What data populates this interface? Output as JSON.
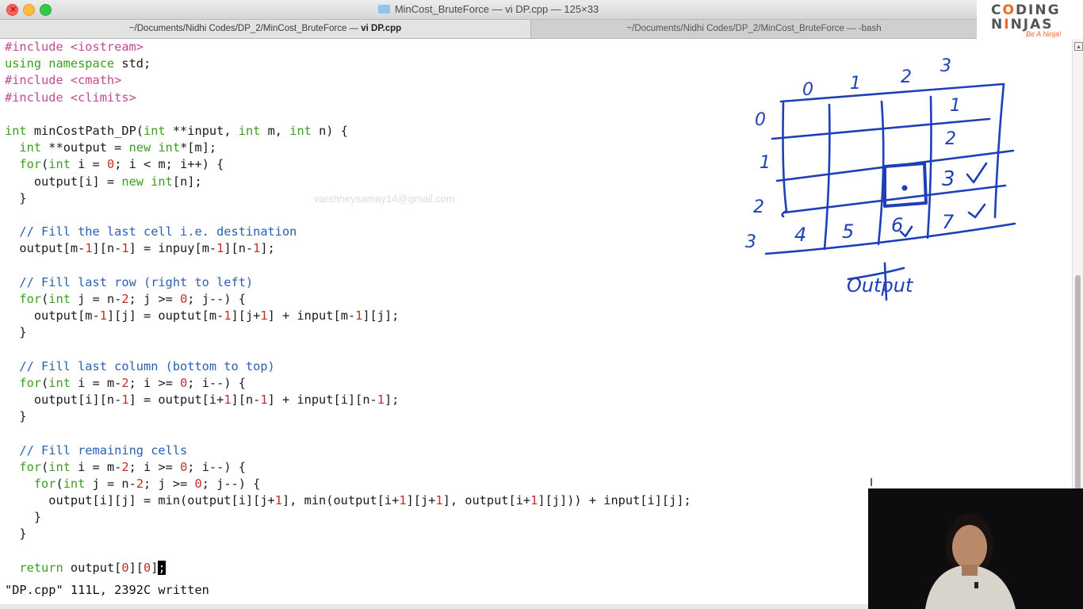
{
  "window": {
    "title": "MinCost_BruteForce — vi DP.cpp — 125×33",
    "close_glyph": "×"
  },
  "tabs": [
    {
      "path": "~/Documents/Nidhi Codes/DP_2/MinCost_BruteForce — ",
      "name": "vi DP.cpp",
      "active": true
    },
    {
      "path": "~/Documents/Nidhi Codes/DP_2/MinCost_BruteForce — -bash",
      "active": false
    }
  ],
  "logo": {
    "line1_a": "C",
    "line1_o": "O",
    "line1_b": "DING",
    "line2_a": "N",
    "line2_o": "I",
    "line2_b": "NJAS",
    "tagline": "Be A Ninja!"
  },
  "editor": {
    "watermark": "varshneysamay14@gmail.com",
    "status": "\"DP.cpp\" 111L, 2392C written",
    "code_lines": [
      [
        {
          "t": "#include <iostream>",
          "c": "pp"
        }
      ],
      [
        {
          "t": "using namespace",
          "c": "kw"
        },
        {
          "t": " std;"
        }
      ],
      [
        {
          "t": "#include <cmath>",
          "c": "pp"
        }
      ],
      [
        {
          "t": "#include <climits>",
          "c": "pp"
        }
      ],
      [],
      [
        {
          "t": "int",
          "c": "kw"
        },
        {
          "t": " minCostPath_DP("
        },
        {
          "t": "int",
          "c": "kw"
        },
        {
          "t": " **input, "
        },
        {
          "t": "int",
          "c": "kw"
        },
        {
          "t": " m, "
        },
        {
          "t": "int",
          "c": "kw"
        },
        {
          "t": " n) {"
        }
      ],
      [
        {
          "t": "  "
        },
        {
          "t": "int",
          "c": "kw"
        },
        {
          "t": " **output = "
        },
        {
          "t": "new",
          "c": "kw"
        },
        {
          "t": " "
        },
        {
          "t": "int",
          "c": "kw"
        },
        {
          "t": "*[m];"
        }
      ],
      [
        {
          "t": "  "
        },
        {
          "t": "for",
          "c": "kw"
        },
        {
          "t": "("
        },
        {
          "t": "int",
          "c": "kw"
        },
        {
          "t": " i = "
        },
        {
          "t": "0",
          "c": "num"
        },
        {
          "t": "; i < m; i++) {"
        }
      ],
      [
        {
          "t": "    output[i] = "
        },
        {
          "t": "new",
          "c": "kw"
        },
        {
          "t": " "
        },
        {
          "t": "int",
          "c": "kw"
        },
        {
          "t": "[n];"
        }
      ],
      [
        {
          "t": "  }"
        }
      ],
      [],
      [
        {
          "t": "  "
        },
        {
          "t": "// Fill the last cell i.e. destination",
          "c": "cm"
        }
      ],
      [
        {
          "t": "  output[m-"
        },
        {
          "t": "1",
          "c": "num"
        },
        {
          "t": "][n-"
        },
        {
          "t": "1",
          "c": "num"
        },
        {
          "t": "] = inpuy[m-"
        },
        {
          "t": "1",
          "c": "num"
        },
        {
          "t": "][n-"
        },
        {
          "t": "1",
          "c": "num"
        },
        {
          "t": "];"
        }
      ],
      [],
      [
        {
          "t": "  "
        },
        {
          "t": "// Fill last row (right to left)",
          "c": "cm"
        }
      ],
      [
        {
          "t": "  "
        },
        {
          "t": "for",
          "c": "kw"
        },
        {
          "t": "("
        },
        {
          "t": "int",
          "c": "kw"
        },
        {
          "t": " j = n-"
        },
        {
          "t": "2",
          "c": "num"
        },
        {
          "t": "; j >= "
        },
        {
          "t": "0",
          "c": "num"
        },
        {
          "t": "; j--) {"
        }
      ],
      [
        {
          "t": "    output[m-"
        },
        {
          "t": "1",
          "c": "num"
        },
        {
          "t": "][j] = ouptut[m-"
        },
        {
          "t": "1",
          "c": "num"
        },
        {
          "t": "][j+"
        },
        {
          "t": "1",
          "c": "num"
        },
        {
          "t": "] + input[m-"
        },
        {
          "t": "1",
          "c": "num"
        },
        {
          "t": "][j];"
        }
      ],
      [
        {
          "t": "  }"
        }
      ],
      [],
      [
        {
          "t": "  "
        },
        {
          "t": "// Fill last column (bottom to top)",
          "c": "cm"
        }
      ],
      [
        {
          "t": "  "
        },
        {
          "t": "for",
          "c": "kw"
        },
        {
          "t": "("
        },
        {
          "t": "int",
          "c": "kw"
        },
        {
          "t": " i = m-"
        },
        {
          "t": "2",
          "c": "num"
        },
        {
          "t": "; i >= "
        },
        {
          "t": "0",
          "c": "num"
        },
        {
          "t": "; i--) {"
        }
      ],
      [
        {
          "t": "    output[i][n-"
        },
        {
          "t": "1",
          "c": "num"
        },
        {
          "t": "] = output[i+"
        },
        {
          "t": "1",
          "c": "num"
        },
        {
          "t": "][n-"
        },
        {
          "t": "1",
          "c": "num"
        },
        {
          "t": "] + input[i][n-"
        },
        {
          "t": "1",
          "c": "num"
        },
        {
          "t": "];"
        }
      ],
      [
        {
          "t": "  }"
        }
      ],
      [],
      [
        {
          "t": "  "
        },
        {
          "t": "// Fill remaining cells",
          "c": "cm"
        }
      ],
      [
        {
          "t": "  "
        },
        {
          "t": "for",
          "c": "kw"
        },
        {
          "t": "("
        },
        {
          "t": "int",
          "c": "kw"
        },
        {
          "t": " i = m-"
        },
        {
          "t": "2",
          "c": "num"
        },
        {
          "t": "; i >= "
        },
        {
          "t": "0",
          "c": "num"
        },
        {
          "t": "; i--) {"
        }
      ],
      [
        {
          "t": "    "
        },
        {
          "t": "for",
          "c": "kw"
        },
        {
          "t": "("
        },
        {
          "t": "int",
          "c": "kw"
        },
        {
          "t": " j = n-"
        },
        {
          "t": "2",
          "c": "num"
        },
        {
          "t": "; j >= "
        },
        {
          "t": "0",
          "c": "num"
        },
        {
          "t": "; j--) {"
        }
      ],
      [
        {
          "t": "      output[i][j] = min(output[i][j+"
        },
        {
          "t": "1",
          "c": "num"
        },
        {
          "t": "], min(output[i+"
        },
        {
          "t": "1",
          "c": "num"
        },
        {
          "t": "][j+"
        },
        {
          "t": "1",
          "c": "num"
        },
        {
          "t": "], output[i+"
        },
        {
          "t": "1",
          "c": "num"
        },
        {
          "t": "][j])) + input[i][j];"
        }
      ],
      [
        {
          "t": "    }"
        }
      ],
      [
        {
          "t": "  }"
        }
      ],
      [],
      [
        {
          "t": "  "
        },
        {
          "t": "return",
          "c": "kw"
        },
        {
          "t": " output["
        },
        {
          "t": "0",
          "c": "num"
        },
        {
          "t": "]["
        },
        {
          "t": "0",
          "c": "num"
        },
        {
          "t": "]"
        },
        {
          "t": ";",
          "c": "cursor"
        }
      ]
    ]
  },
  "drawing": {
    "col_labels": [
      "0",
      "1",
      "2",
      "3"
    ],
    "row_labels": [
      "0",
      "1",
      "2",
      "3"
    ],
    "cells": [
      "1",
      "2",
      "3",
      "4",
      "5",
      "6",
      "7"
    ],
    "caption": "Output"
  },
  "colors": {
    "keyword": "#3c9e1e",
    "preprocessor": "#c24b8f",
    "number": "#c72b2b",
    "comment": "#2a5fb0",
    "ink": "#1e3fb8"
  }
}
